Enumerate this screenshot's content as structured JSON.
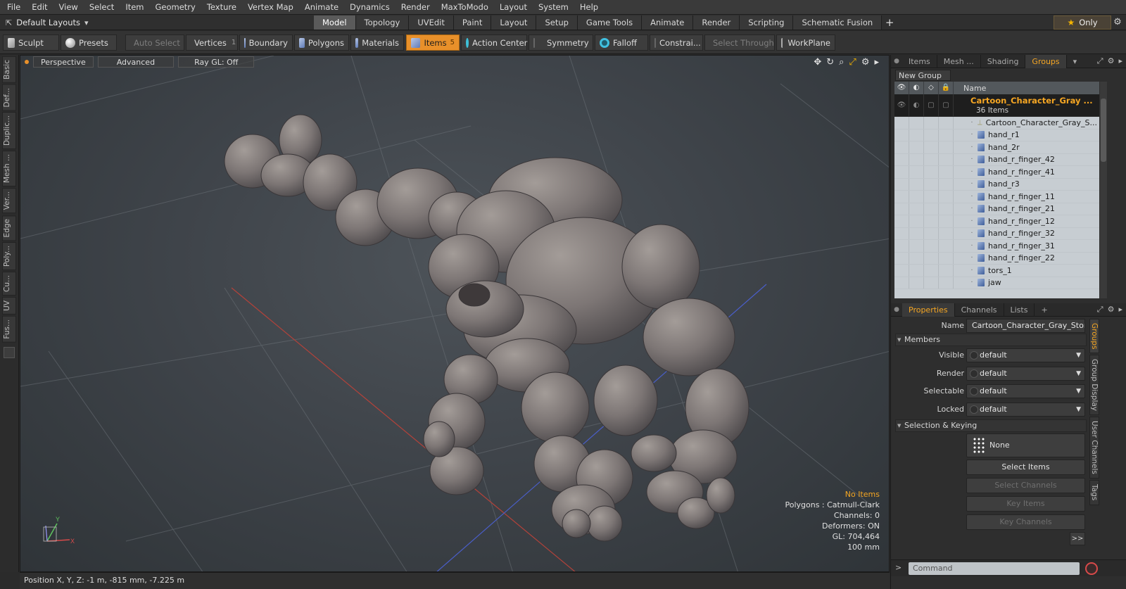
{
  "menubar": [
    "File",
    "Edit",
    "View",
    "Select",
    "Item",
    "Geometry",
    "Texture",
    "Vertex Map",
    "Animate",
    "Dynamics",
    "Render",
    "MaxToModo",
    "Layout",
    "System",
    "Help"
  ],
  "layout_selector": "Default Layouts",
  "tabs": [
    {
      "label": "Model",
      "active": true
    },
    {
      "label": "Topology",
      "active": false
    },
    {
      "label": "UVEdit",
      "active": false
    },
    {
      "label": "Paint",
      "active": false
    },
    {
      "label": "Layout",
      "active": false
    },
    {
      "label": "Setup",
      "active": false
    },
    {
      "label": "Game Tools",
      "active": false
    },
    {
      "label": "Animate",
      "active": false
    },
    {
      "label": "Render",
      "active": false
    },
    {
      "label": "Scripting",
      "active": false
    },
    {
      "label": "Schematic Fusion",
      "active": false
    }
  ],
  "only_label": "Only",
  "toolbar": {
    "sculpt": "Sculpt",
    "presets": "Presets",
    "auto_select": "Auto Select",
    "vertices": "Vertices",
    "vertices_count": "1",
    "boundary": "Boundary",
    "polygons": "Polygons",
    "materials": "Materials",
    "items": "Items",
    "items_count": "5",
    "action_center": "Action Center",
    "symmetry": "Symmetry",
    "falloff": "Falloff",
    "constraints": "Constrai...",
    "select_through": "Select Through",
    "workplane": "WorkPlane"
  },
  "left_strip": [
    "Basic",
    "Def...",
    "Duplic...",
    "Mesh ...",
    "Ver...",
    "Edge",
    "Poly...",
    "Cu...",
    "UV",
    "Fus..."
  ],
  "viewport": {
    "view_mode": "Perspective",
    "advanced": "Advanced",
    "raygl": "Ray GL: Off",
    "hud": {
      "selection": "No Items",
      "polygons": "Polygons : Catmull-Clark",
      "channels": "Channels: 0",
      "deformers": "Deformers: ON",
      "gl": "GL: 704,464",
      "scale": "100 mm"
    },
    "axis_y": "Y",
    "axis_x": "X"
  },
  "status": {
    "position": "Position X, Y, Z:  -1 m, -815 mm, -7.225 m"
  },
  "panel_tabs_top": [
    {
      "label": "Items",
      "active": false
    },
    {
      "label": "Mesh ...",
      "active": false
    },
    {
      "label": "Shading",
      "active": false
    },
    {
      "label": "Groups",
      "active": true
    }
  ],
  "groups": {
    "new_group": "New Group",
    "name_header": "Name",
    "group_name": "Cartoon_Character_Gray ...",
    "group_count": "36 Items",
    "items": [
      {
        "name": "Cartoon_Character_Gray_S...",
        "kind": "locator"
      },
      {
        "name": "hand_r1",
        "kind": "mesh"
      },
      {
        "name": "hand_2r",
        "kind": "mesh"
      },
      {
        "name": "hand_r_finger_42",
        "kind": "mesh"
      },
      {
        "name": "hand_r_finger_41",
        "kind": "mesh"
      },
      {
        "name": "hand_r3",
        "kind": "mesh"
      },
      {
        "name": "hand_r_finger_11",
        "kind": "mesh"
      },
      {
        "name": "hand_r_finger_21",
        "kind": "mesh"
      },
      {
        "name": "hand_r_finger_12",
        "kind": "mesh"
      },
      {
        "name": "hand_r_finger_32",
        "kind": "mesh"
      },
      {
        "name": "hand_r_finger_31",
        "kind": "mesh"
      },
      {
        "name": "hand_r_finger_22",
        "kind": "mesh"
      },
      {
        "name": "tors_1",
        "kind": "mesh"
      },
      {
        "name": "jaw",
        "kind": "mesh"
      }
    ]
  },
  "panel_tabs_bottom": [
    {
      "label": "Properties",
      "active": true
    },
    {
      "label": "Channels",
      "active": false
    },
    {
      "label": "Lists",
      "active": false
    }
  ],
  "properties": {
    "name_label": "Name",
    "name_value": "Cartoon_Character_Gray_Stone_",
    "members_section": "Members",
    "visible_label": "Visible",
    "visible_value": "default",
    "render_label": "Render",
    "render_value": "default",
    "selectable_label": "Selectable",
    "selectable_value": "default",
    "locked_label": "Locked",
    "locked_value": "default",
    "keying_section": "Selection & Keying",
    "none_button": "None",
    "select_items": "Select Items",
    "select_channels": "Select Channels",
    "key_items": "Key Items",
    "key_channels": "Key Channels",
    "more": ">>"
  },
  "side_tabs": [
    {
      "label": "Groups",
      "active": true
    },
    {
      "label": "Group Display",
      "active": false
    },
    {
      "label": "User Channels",
      "active": false
    },
    {
      "label": "Tags",
      "active": false
    }
  ],
  "command_placeholder": "Command",
  "colors": {
    "accent": "#e8902a",
    "group_name": "#f5a623",
    "viewport_bg": "#3f444a"
  }
}
